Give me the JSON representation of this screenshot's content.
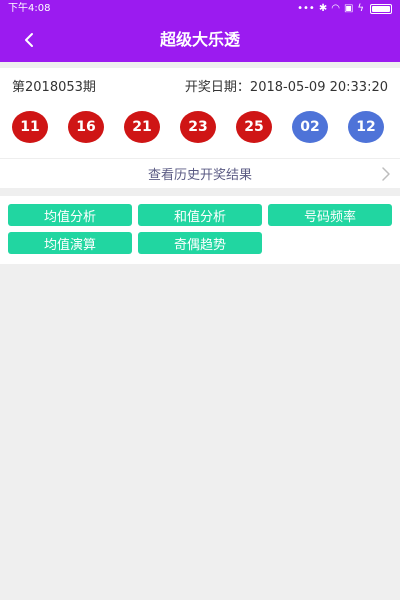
{
  "status_bar": {
    "time": "下午4:08",
    "icons": [
      "dots-icon",
      "bluetooth-icon",
      "wifi-icon",
      "sim-icon",
      "charging-icon",
      "battery-icon"
    ]
  },
  "navbar": {
    "title": "超级大乐透",
    "back_icon": "chevron-left-icon"
  },
  "draw": {
    "issue": "第2018053期",
    "date": "开奖日期：2018-05-09 20:33:20",
    "red_balls": [
      "11",
      "16",
      "21",
      "23",
      "25"
    ],
    "blue_balls": [
      "02",
      "12"
    ],
    "history_link": "查看历史开奖结果"
  },
  "features": [
    {
      "label": "均值分析"
    },
    {
      "label": "和值分析"
    },
    {
      "label": "号码频率"
    },
    {
      "label": "均值演算"
    },
    {
      "label": "奇偶趋势"
    }
  ],
  "colors": {
    "header": "#9b1bf0",
    "red_ball": "#cf1515",
    "blue_ball": "#4e73d8",
    "feature_button": "#21d6a1",
    "background": "#efefef"
  }
}
